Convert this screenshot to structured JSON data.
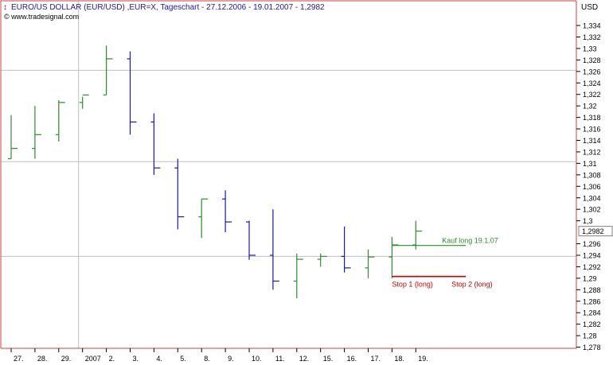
{
  "header": {
    "title": "EURO/US DOLLAR (EUR/USD) ,EUR=X, Tageschart - 27.12.2006 - 19.01.2007 - 1,2982",
    "copyright": "© www.tradesignal.com",
    "currency": "USD"
  },
  "colors": {
    "up": "#2e8b2e",
    "down": "#1a1aa6",
    "grid": "#c0c0c0",
    "frame": "#d04040",
    "stop": "#cc0000",
    "signal": "#2e8b2e"
  },
  "chart_data": {
    "type": "ohlc",
    "title": "EURO/US DOLLAR (EUR/USD) ,EUR=X, Tageschart - 27.12.2006 - 19.01.2007 - 1,2982",
    "ylabel": "USD",
    "ylim": [
      1.2778,
      1.3383
    ],
    "y_ticks": [
      1.278,
      1.28,
      1.282,
      1.284,
      1.286,
      1.288,
      1.29,
      1.292,
      1.294,
      1.296,
      1.3,
      1.302,
      1.304,
      1.306,
      1.308,
      1.31,
      1.312,
      1.314,
      1.316,
      1.318,
      1.32,
      1.322,
      1.324,
      1.326,
      1.328,
      1.33,
      1.332,
      1.334
    ],
    "y_tick_labels": [
      "1,278",
      "1,28",
      "1,282",
      "1,284",
      "1,286",
      "1,288",
      "1,29",
      "1,292",
      "1,294",
      "1,296",
      "1,3",
      "1,302",
      "1,304",
      "1,306",
      "1,308",
      "1,31",
      "1,312",
      "1,314",
      "1,316",
      "1,318",
      "1,32",
      "1,322",
      "1,324",
      "1,326",
      "1,328",
      "1,33",
      "1,332",
      "1,334"
    ],
    "last_price_label": "1,2982",
    "last_price": 1.2982,
    "grid_y": [
      1.3262,
      1.3103,
      1.2938
    ],
    "vertical_grid_category": "2007",
    "categories": [
      "27.",
      "28.",
      "29.",
      "2007",
      "2.",
      "3.",
      "4.",
      "5.",
      "8.",
      "9.",
      "10.",
      "11.",
      "12.",
      "15.",
      "16.",
      "17.",
      "18.",
      "19."
    ],
    "bars": [
      {
        "open": 1.3108,
        "high": 1.3184,
        "low": 1.3108,
        "close": 1.3126
      },
      {
        "open": 1.3126,
        "high": 1.32,
        "low": 1.3108,
        "close": 1.315
      },
      {
        "open": 1.315,
        "high": 1.321,
        "low": 1.3138,
        "close": 1.3206
      },
      {
        "open": 1.3206,
        "high": 1.3216,
        "low": 1.3195,
        "close": 1.3219
      },
      {
        "open": 1.3219,
        "high": 1.3305,
        "low": 1.3219,
        "close": 1.3282
      },
      {
        "open": 1.3282,
        "high": 1.3295,
        "low": 1.315,
        "close": 1.3172
      },
      {
        "open": 1.3172,
        "high": 1.3187,
        "low": 1.308,
        "close": 1.3092
      },
      {
        "open": 1.3092,
        "high": 1.3108,
        "low": 1.2985,
        "close": 1.3007
      },
      {
        "open": 1.3007,
        "high": 1.3038,
        "low": 1.297,
        "close": 1.3038
      },
      {
        "open": 1.3038,
        "high": 1.3053,
        "low": 1.298,
        "close": 1.2998
      },
      {
        "open": 1.2998,
        "high": 1.3,
        "low": 1.2932,
        "close": 1.294
      },
      {
        "open": 1.294,
        "high": 1.302,
        "low": 1.288,
        "close": 1.2895
      },
      {
        "open": 1.2895,
        "high": 1.2943,
        "low": 1.2865,
        "close": 1.2933
      },
      {
        "open": 1.2933,
        "high": 1.2943,
        "low": 1.292,
        "close": 1.2938
      },
      {
        "open": 1.2938,
        "high": 1.299,
        "low": 1.291,
        "close": 1.2918
      },
      {
        "open": 1.2918,
        "high": 1.295,
        "low": 1.29,
        "close": 1.2937
      },
      {
        "open": 1.2937,
        "high": 1.2972,
        "low": 1.29,
        "close": 1.2958
      },
      {
        "open": 1.2958,
        "high": 1.3,
        "low": 1.295,
        "close": 1.2982
      }
    ],
    "signals": [
      {
        "label": "Kauf long 19.1.07",
        "price": 1.2957,
        "from_bar": 16,
        "to_bar": 19,
        "color": "#2e8b2e"
      }
    ],
    "stops": [
      {
        "label": "Stop 1 (long)",
        "price": 1.2903,
        "from_bar": 16,
        "to_bar": 17
      },
      {
        "label": "Stop 2 (long)",
        "price": 1.2903,
        "from_bar": 17,
        "to_bar": 19
      }
    ]
  }
}
